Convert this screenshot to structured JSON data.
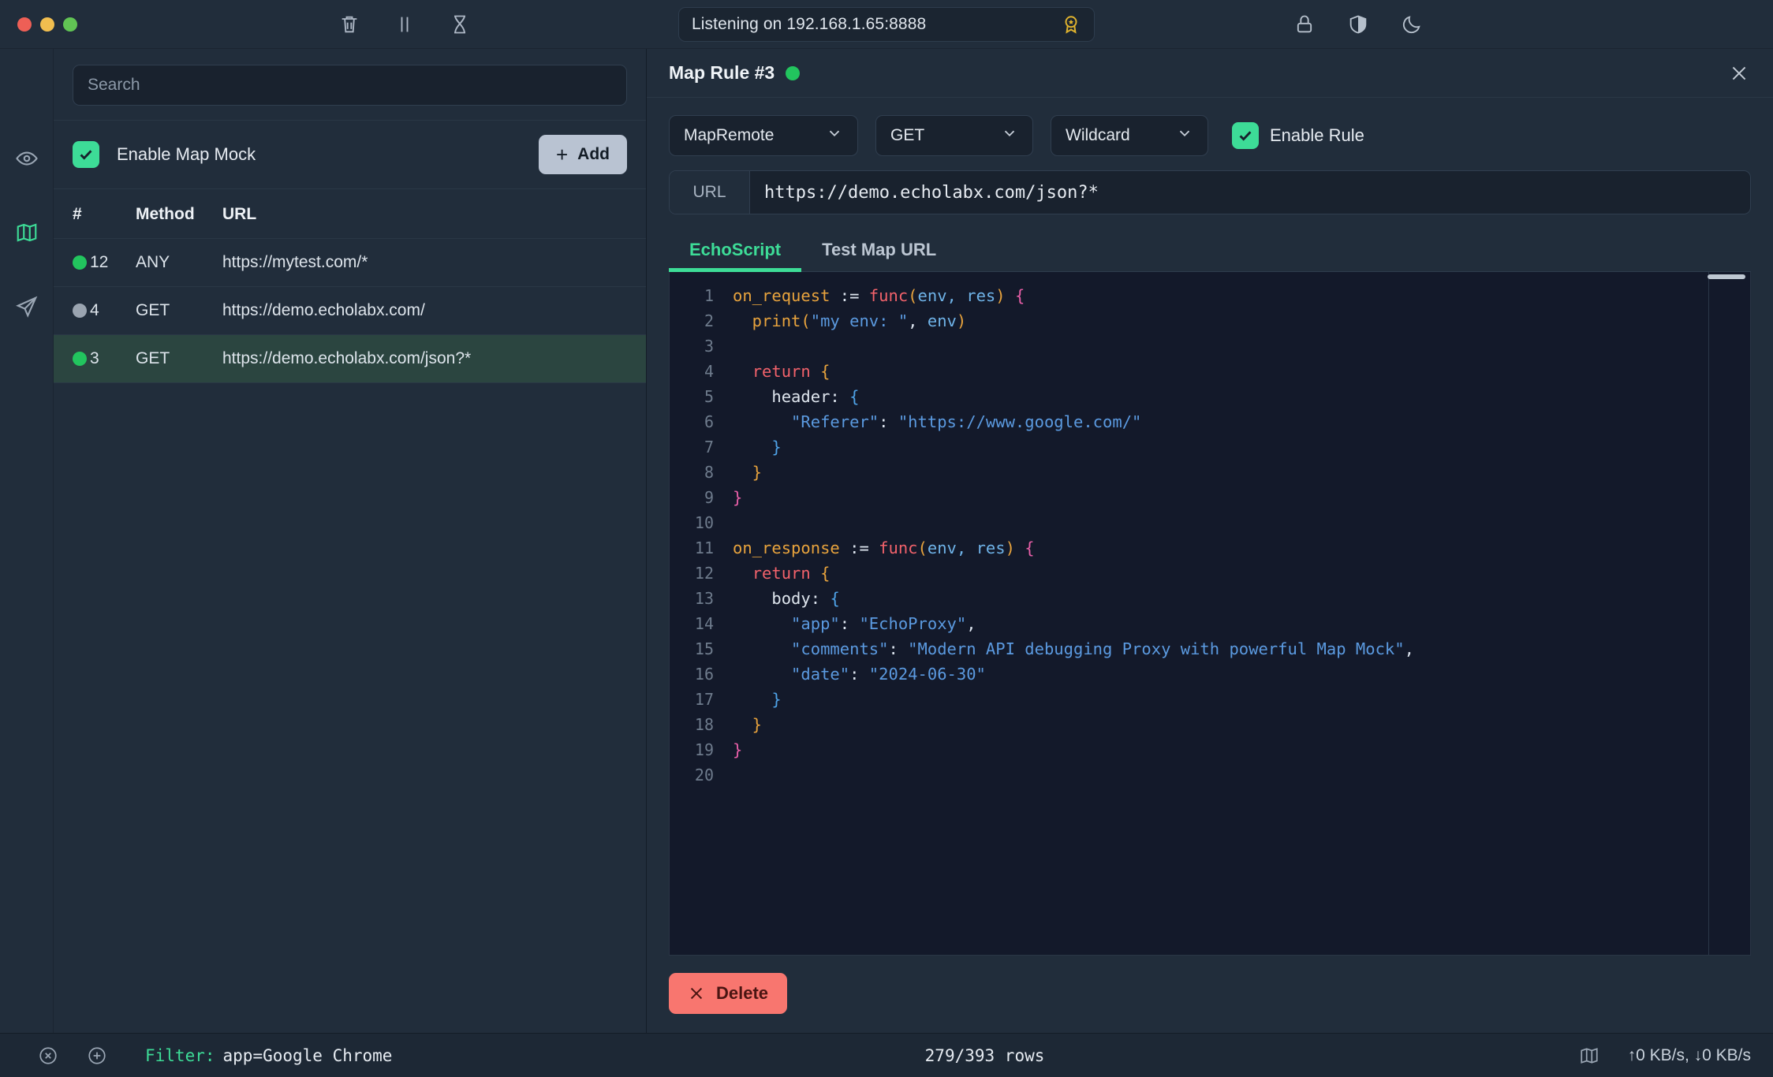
{
  "titlebar": {
    "window_controls": [
      "close",
      "minimize",
      "maximize"
    ],
    "icons": [
      "trash-icon",
      "pause-icon",
      "hourglass-icon"
    ],
    "listening_status": "Listening on 192.168.1.65:8888",
    "badge_icon": "award-badge-icon",
    "right_icons": [
      "lock-icon",
      "shield-icon",
      "moon-icon"
    ]
  },
  "rail": {
    "items": [
      {
        "icon": "eye-icon",
        "name": "inspect",
        "active": false
      },
      {
        "icon": "map-icon",
        "name": "map-mock",
        "active": true
      },
      {
        "icon": "send-icon",
        "name": "compose",
        "active": false
      }
    ]
  },
  "left_panel": {
    "search": {
      "placeholder": "Search",
      "value": ""
    },
    "enable_map_mock_label": "Enable Map Mock",
    "enable_map_mock_checked": true,
    "add_label": "Add",
    "table": {
      "headers": {
        "num": "#",
        "method": "Method",
        "url": "URL"
      },
      "rows": [
        {
          "status": "on",
          "num": "12",
          "method": "ANY",
          "url": "https://mytest.com/*",
          "selected": false
        },
        {
          "status": "off",
          "num": "4",
          "method": "GET",
          "url": "https://demo.echolabx.com/",
          "selected": false
        },
        {
          "status": "on",
          "num": "3",
          "method": "GET",
          "url": "https://demo.echolabx.com/json?*",
          "selected": true
        }
      ]
    }
  },
  "right_panel": {
    "title": "Map Rule #3",
    "title_status": "on",
    "close_icon": "close-icon",
    "controls": {
      "type_select": "MapRemote",
      "method_select": "GET",
      "match_select": "Wildcard",
      "enable_rule_label": "Enable Rule",
      "enable_rule_checked": true
    },
    "url_field": {
      "label": "URL",
      "value": "https://demo.echolabx.com/json?*"
    },
    "tabs": [
      {
        "label": "EchoScript",
        "active": true
      },
      {
        "label": "Test Map URL",
        "active": false
      }
    ],
    "editor": {
      "line_numbers": [
        "1",
        "2",
        "3",
        "4",
        "5",
        "6",
        "7",
        "8",
        "9",
        "10",
        "11",
        "12",
        "13",
        "14",
        "15",
        "16",
        "17",
        "18",
        "19",
        "20"
      ],
      "lines": [
        [
          {
            "t": "on_request ",
            "c": "t-fn"
          },
          {
            "t": ":= ",
            "c": "t-op"
          },
          {
            "t": "func",
            "c": "t-kw"
          },
          {
            "t": "(",
            "c": "t-brc2"
          },
          {
            "t": "env, res",
            "c": "t-par"
          },
          {
            "t": ")",
            "c": "t-brc2"
          },
          {
            "t": " ",
            "c": "t-op"
          },
          {
            "t": "{",
            "c": "t-brc1"
          }
        ],
        [
          {
            "t": "  print",
            "c": "t-fn"
          },
          {
            "t": "(",
            "c": "t-brc2"
          },
          {
            "t": "\"my env: \"",
            "c": "t-str"
          },
          {
            "t": ", ",
            "c": "t-punc"
          },
          {
            "t": "env",
            "c": "t-par"
          },
          {
            "t": ")",
            "c": "t-brc2"
          }
        ],
        [],
        [
          {
            "t": "  ",
            "c": "t-op"
          },
          {
            "t": "return",
            "c": "t-kw"
          },
          {
            "t": " ",
            "c": "t-op"
          },
          {
            "t": "{",
            "c": "t-brc2"
          }
        ],
        [
          {
            "t": "    header",
            "c": "t-key"
          },
          {
            "t": ": ",
            "c": "t-punc"
          },
          {
            "t": "{",
            "c": "t-brc3"
          }
        ],
        [
          {
            "t": "      \"Referer\"",
            "c": "t-str"
          },
          {
            "t": ": ",
            "c": "t-punc"
          },
          {
            "t": "\"https://www.google.com/\"",
            "c": "t-str"
          }
        ],
        [
          {
            "t": "    }",
            "c": "t-brc3"
          }
        ],
        [
          {
            "t": "  }",
            "c": "t-brc2"
          }
        ],
        [
          {
            "t": "}",
            "c": "t-brc1"
          }
        ],
        [],
        [
          {
            "t": "on_response ",
            "c": "t-fn"
          },
          {
            "t": ":= ",
            "c": "t-op"
          },
          {
            "t": "func",
            "c": "t-kw"
          },
          {
            "t": "(",
            "c": "t-brc2"
          },
          {
            "t": "env, res",
            "c": "t-par"
          },
          {
            "t": ")",
            "c": "t-brc2"
          },
          {
            "t": " ",
            "c": "t-op"
          },
          {
            "t": "{",
            "c": "t-brc1"
          }
        ],
        [
          {
            "t": "  ",
            "c": "t-op"
          },
          {
            "t": "return",
            "c": "t-kw"
          },
          {
            "t": " ",
            "c": "t-op"
          },
          {
            "t": "{",
            "c": "t-brc2"
          }
        ],
        [
          {
            "t": "    body",
            "c": "t-key"
          },
          {
            "t": ": ",
            "c": "t-punc"
          },
          {
            "t": "{",
            "c": "t-brc3"
          }
        ],
        [
          {
            "t": "      \"app\"",
            "c": "t-str"
          },
          {
            "t": ": ",
            "c": "t-punc"
          },
          {
            "t": "\"EchoProxy\"",
            "c": "t-str"
          },
          {
            "t": ",",
            "c": "t-punc"
          }
        ],
        [
          {
            "t": "      \"comments\"",
            "c": "t-str"
          },
          {
            "t": ": ",
            "c": "t-punc"
          },
          {
            "t": "\"Modern API debugging Proxy with powerful Map Mock\"",
            "c": "t-str"
          },
          {
            "t": ",",
            "c": "t-punc"
          }
        ],
        [
          {
            "t": "      \"date\"",
            "c": "t-str"
          },
          {
            "t": ": ",
            "c": "t-punc"
          },
          {
            "t": "\"2024-06-30\"",
            "c": "t-str"
          }
        ],
        [
          {
            "t": "    }",
            "c": "t-brc3"
          }
        ],
        [
          {
            "t": "  }",
            "c": "t-brc2"
          }
        ],
        [
          {
            "t": "}",
            "c": "t-brc1"
          }
        ],
        []
      ]
    },
    "delete_label": "Delete"
  },
  "statusbar": {
    "clear_icon": "clear-circle-icon",
    "add_icon": "add-circle-icon",
    "filter_label": "Filter:",
    "filter_value": "app=Google Chrome",
    "rows_count": "279/393 rows",
    "map_icon": "map-icon",
    "speed": "↑0 KB/s, ↓0 KB/s"
  },
  "colors": {
    "accent_green": "#3ddc97",
    "status_on": "#22c55e",
    "status_off": "#9aa4b0",
    "danger": "#f8766f",
    "panel_bg": "#212d3b",
    "editor_bg": "#13192a"
  }
}
